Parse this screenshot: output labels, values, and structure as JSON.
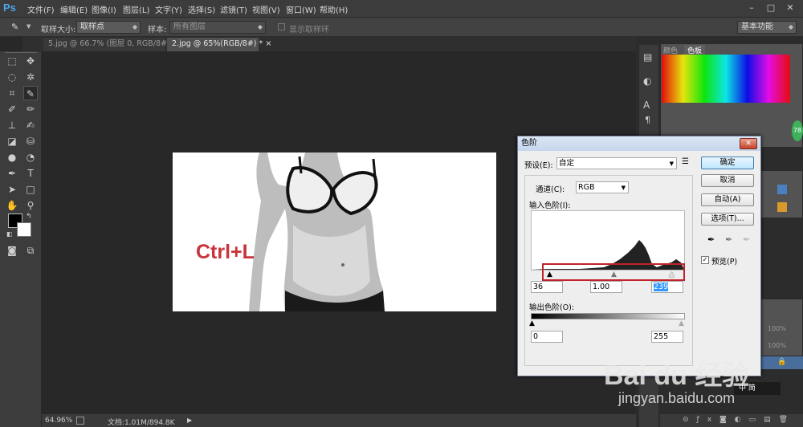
{
  "app": {
    "logo": "Ps"
  },
  "menu": [
    "文件(F)",
    "编辑(E)",
    "图像(I)",
    "图层(L)",
    "文字(Y)",
    "选择(S)",
    "滤镜(T)",
    "视图(V)",
    "窗口(W)",
    "帮助(H)"
  ],
  "window_controls": [
    "–",
    "□",
    "✕"
  ],
  "options": {
    "sample_size_label": "取样大小:",
    "sample_size_value": "取样点",
    "sample_label": "样本:",
    "sample_value": "所有图层",
    "show_ring_label": "显示取样环",
    "workspace": "基本功能"
  },
  "tabs": [
    {
      "label": "5.jpg @ 66.7% (图层 0, RGB/8#) *",
      "close": "×",
      "active": false
    },
    {
      "label": "2.jpg @ 65%(RGB/8#) *",
      "close": "×",
      "active": true
    }
  ],
  "status": {
    "zoom": "64.96%",
    "doc": "文档:1.01M/894.8K"
  },
  "right_panel": {
    "tab_color": "颜色",
    "tab_swatches": "色板",
    "badge": "78",
    "zoom1": "100%",
    "zoom2": "100%"
  },
  "image": {
    "overlay_text": "Ctrl+L"
  },
  "levels": {
    "title": "色阶",
    "close": "✕",
    "preset_label": "预设(E):",
    "preset_value": "自定",
    "channel_label": "通道(C):",
    "channel_value": "RGB",
    "input_label": "输入色阶(I):",
    "input_black": "36",
    "input_gamma": "1.00",
    "input_white": "239",
    "output_label": "输出色阶(O):",
    "output_black": "0",
    "output_white": "255",
    "ok": "确定",
    "cancel": "取消",
    "auto": "自动(A)",
    "options": "选项(T)...",
    "preview": "预览(P)",
    "preview_checked": true,
    "highlight_color": "#c0232b"
  },
  "ime": {
    "text": "中",
    "text2": "简"
  },
  "watermark": {
    "brand": "Bai du 经验",
    "url": "jingyan.baidu.com"
  },
  "colors": {
    "accent": "#4aa8e8",
    "bg": "#282828"
  }
}
